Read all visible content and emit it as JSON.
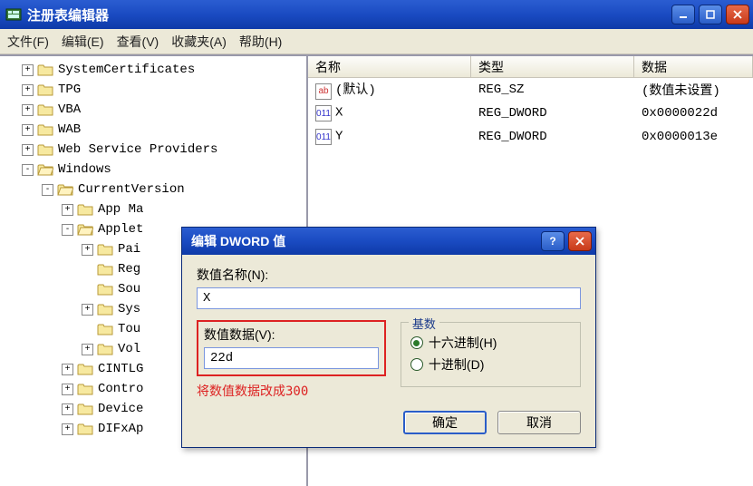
{
  "window": {
    "title": "注册表编辑器"
  },
  "menu": {
    "file": "文件(F)",
    "edit": "编辑(E)",
    "view": "查看(V)",
    "favorites": "收藏夹(A)",
    "help": "帮助(H)"
  },
  "tree": [
    {
      "indent": 1,
      "exp": "+",
      "label": "SystemCertificates"
    },
    {
      "indent": 1,
      "exp": "+",
      "label": "TPG"
    },
    {
      "indent": 1,
      "exp": "+",
      "label": "VBA"
    },
    {
      "indent": 1,
      "exp": "+",
      "label": "WAB"
    },
    {
      "indent": 1,
      "exp": "+",
      "label": "Web Service Providers"
    },
    {
      "indent": 1,
      "exp": "-",
      "label": "Windows",
      "open": true
    },
    {
      "indent": 2,
      "exp": "-",
      "label": "CurrentVersion",
      "open": true
    },
    {
      "indent": 3,
      "exp": "+",
      "label": "App Ma"
    },
    {
      "indent": 3,
      "exp": "-",
      "label": "Applet",
      "open": true
    },
    {
      "indent": 4,
      "exp": "+",
      "label": "Pai"
    },
    {
      "indent": 4,
      "exp": "",
      "label": "Reg"
    },
    {
      "indent": 4,
      "exp": "",
      "label": "Sou"
    },
    {
      "indent": 4,
      "exp": "+",
      "label": "Sys"
    },
    {
      "indent": 4,
      "exp": "",
      "label": "Tou"
    },
    {
      "indent": 4,
      "exp": "+",
      "label": "Vol"
    },
    {
      "indent": 3,
      "exp": "+",
      "label": "CINTLG"
    },
    {
      "indent": 3,
      "exp": "+",
      "label": "Contro"
    },
    {
      "indent": 3,
      "exp": "+",
      "label": "Device"
    },
    {
      "indent": 3,
      "exp": "+",
      "label": "DIFxAp"
    }
  ],
  "list": {
    "headers": {
      "name": "名称",
      "type": "类型",
      "data": "数据"
    },
    "rows": [
      {
        "icon": "str",
        "name": "(默认)",
        "type": "REG_SZ",
        "data": "(数值未设置)"
      },
      {
        "icon": "bin",
        "name": "X",
        "type": "REG_DWORD",
        "data": "0x0000022d"
      },
      {
        "icon": "bin",
        "name": "Y",
        "type": "REG_DWORD",
        "data": "0x0000013e"
      }
    ]
  },
  "dialog": {
    "title": "编辑 DWORD 值",
    "name_label": "数值名称(N):",
    "name_value": "X",
    "data_label": "数值数据(V):",
    "data_value": "22d",
    "base_label": "基数",
    "hex_label": "十六进制(H)",
    "dec_label": "十进制(D)",
    "annotation": "将数值数据改成300",
    "ok": "确定",
    "cancel": "取消"
  }
}
